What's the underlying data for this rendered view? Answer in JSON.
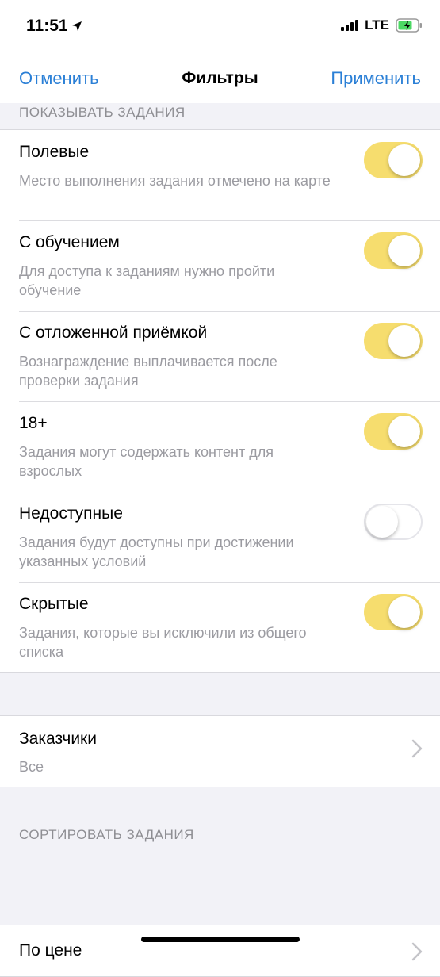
{
  "status": {
    "time": "11:51",
    "network": "LTE",
    "location_icon": "location-arrow-icon",
    "battery_icon": "battery-charging-icon"
  },
  "nav": {
    "cancel": "Отменить",
    "title": "Фильтры",
    "apply": "Применить"
  },
  "show_section": {
    "header": "ПОКАЗЫВАТЬ ЗАДАНИЯ",
    "items": [
      {
        "title": "Полевые",
        "desc": "Место выполнения задания отмечено на карте",
        "enabled": true
      },
      {
        "title": "С обучением",
        "desc": "Для доступа к заданиям нужно пройти обучение",
        "enabled": true
      },
      {
        "title": "С отложенной приёмкой",
        "desc": "Вознаграждение выплачивается после проверки задания",
        "enabled": true
      },
      {
        "title": "18+",
        "desc": "Задания могут содержать контент для взрослых",
        "enabled": true
      },
      {
        "title": "Недоступные",
        "desc": "Задания будут доступны при достижении указанных условий",
        "enabled": false
      },
      {
        "title": "Скрытые",
        "desc": "Задания, которые вы исключили из общего списка",
        "enabled": true
      }
    ]
  },
  "customers": {
    "title": "Заказчики",
    "value": "Все"
  },
  "sort_section": {
    "header": "СОРТИРОВАТЬ ЗАДАНИЯ",
    "value": "По цене"
  },
  "colors": {
    "accent": "#2a7fd6",
    "toggle_on": "#f6dd6e",
    "background": "#f2f2f7"
  }
}
